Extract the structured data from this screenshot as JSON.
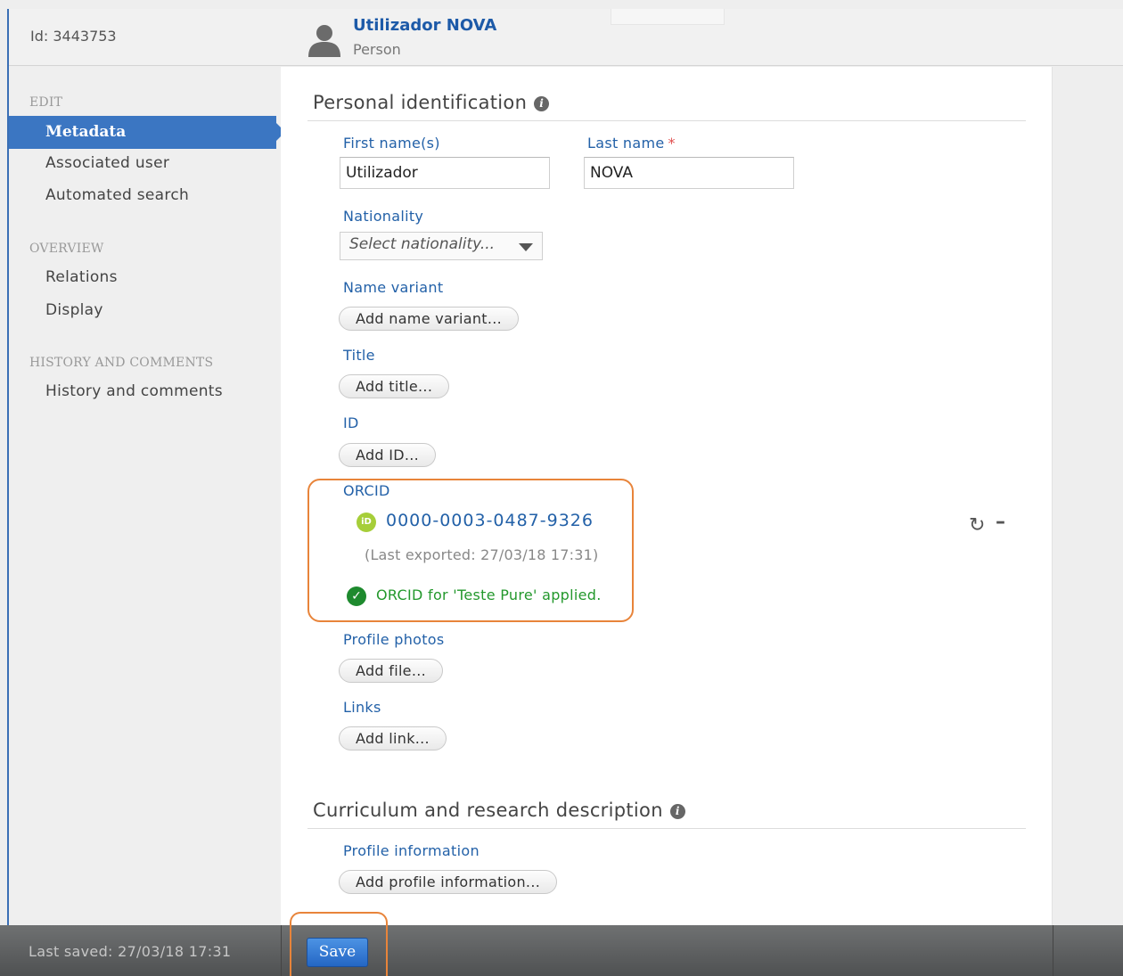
{
  "header": {
    "id_label": "Id: 3443753",
    "name": "Utilizador NOVA",
    "type": "Person"
  },
  "sidebar": {
    "sections": [
      {
        "title": "EDIT",
        "items": [
          "Metadata",
          "Associated user",
          "Automated search"
        ]
      },
      {
        "title": "OVERVIEW",
        "items": [
          "Relations",
          "Display"
        ]
      },
      {
        "title": "HISTORY AND COMMENTS",
        "items": [
          "History and comments"
        ]
      }
    ],
    "active_item": "Metadata"
  },
  "personal": {
    "title": "Personal identification",
    "first_name_label": "First name(s)",
    "first_name_value": "Utilizador",
    "last_name_label": "Last name",
    "required_mark": "*",
    "last_name_value": "NOVA",
    "nationality_label": "Nationality",
    "nationality_placeholder": "Select nationality...",
    "name_variant_label": "Name variant",
    "name_variant_button": "Add name variant...",
    "title_label": "Title",
    "title_button": "Add title...",
    "id_label": "ID",
    "id_button": "Add ID...",
    "orcid_label": "ORCID",
    "orcid_logo_text": "iD",
    "orcid_value": "0000-0003-0487-9326",
    "orcid_last_exported": "(Last exported: 27/03/18 17:31)",
    "orcid_applied": "ORCID for 'Teste Pure' applied.",
    "photos_label": "Profile photos",
    "photos_button": "Add file...",
    "links_label": "Links",
    "links_button": "Add link..."
  },
  "curriculum": {
    "title": "Curriculum and research description",
    "profile_label": "Profile information",
    "profile_button": "Add profile information..."
  },
  "footer": {
    "last_saved": "Last saved: 27/03/18 17:31",
    "save_label": "Save"
  },
  "colors": {
    "accent": "#3b76c2",
    "link": "#2361a8",
    "success": "#23982c",
    "highlight": "#e8843a",
    "orcid": "#a6ce39"
  }
}
